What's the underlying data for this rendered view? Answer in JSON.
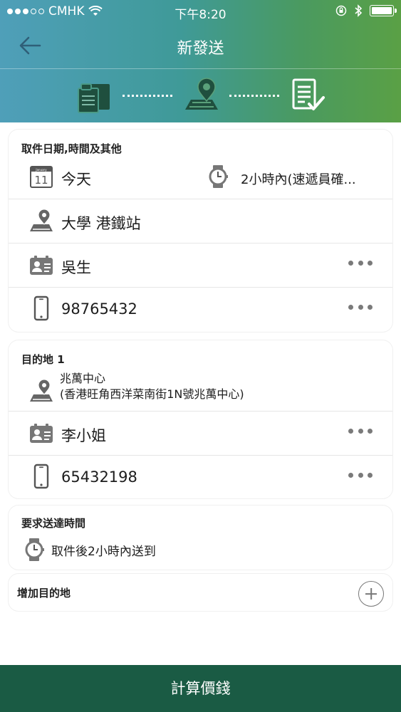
{
  "status_bar": {
    "carrier": "CMHK",
    "time": "下午8:20"
  },
  "nav": {
    "title": "新發送",
    "back_icon": "arrow-left-icon"
  },
  "steps": {
    "icons": [
      "documents-icon",
      "map-pin-icon",
      "checklist-icon"
    ]
  },
  "pickup": {
    "title": "取件日期,時間及其他",
    "calendar_icon_text": "11",
    "calendar_icon_month": "January",
    "date": "今天",
    "time": "2小時內(速遞員確...",
    "location": "大學 港鐵站",
    "contact_name": "吳生",
    "phone": "98765432"
  },
  "destination1": {
    "title": "目的地 1",
    "place_name": "兆萬中心",
    "address": "(香港旺角西洋菜南街1N號兆萬中心)",
    "contact_name": "李小姐",
    "phone": "65432198"
  },
  "delivery_time": {
    "title": "要求送達時間",
    "value": "取件後2小時內送到"
  },
  "add_destination": {
    "label": "增加目的地"
  },
  "bottom_button": {
    "label": "計算價錢"
  },
  "colors": {
    "header_start": "#4f9fb9",
    "header_end": "#5aa045",
    "bottom_bar": "#1a5b44",
    "icon_dark": "#1f4f3e"
  }
}
